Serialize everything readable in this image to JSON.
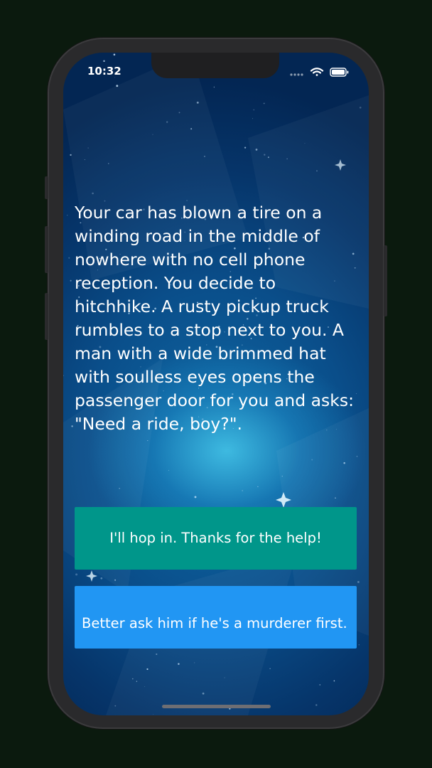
{
  "status_bar": {
    "time": "10:32",
    "icons": [
      "signal-dots-icon",
      "wifi-icon",
      "battery-icon"
    ]
  },
  "story": {
    "text": "Your car has blown a tire on a winding road in the middle of nowhere with no cell phone reception. You decide to hitchhike. A rusty pickup truck rumbles to a stop next to you. A man with a wide brimmed hat with soulless eyes opens the passenger door for you and asks: \"Need a ride, boy?\"."
  },
  "choices": [
    {
      "label": "I'll hop in. Thanks for the help!",
      "color": "#00968a"
    },
    {
      "label": "Better ask him if he's a murderer first.",
      "color": "#2196f3"
    }
  ],
  "colors": {
    "background": "#0b1a0e",
    "phone_frame": "#2a2a2c",
    "screen_glow": "#46c8eb",
    "screen_deep": "#032653"
  }
}
